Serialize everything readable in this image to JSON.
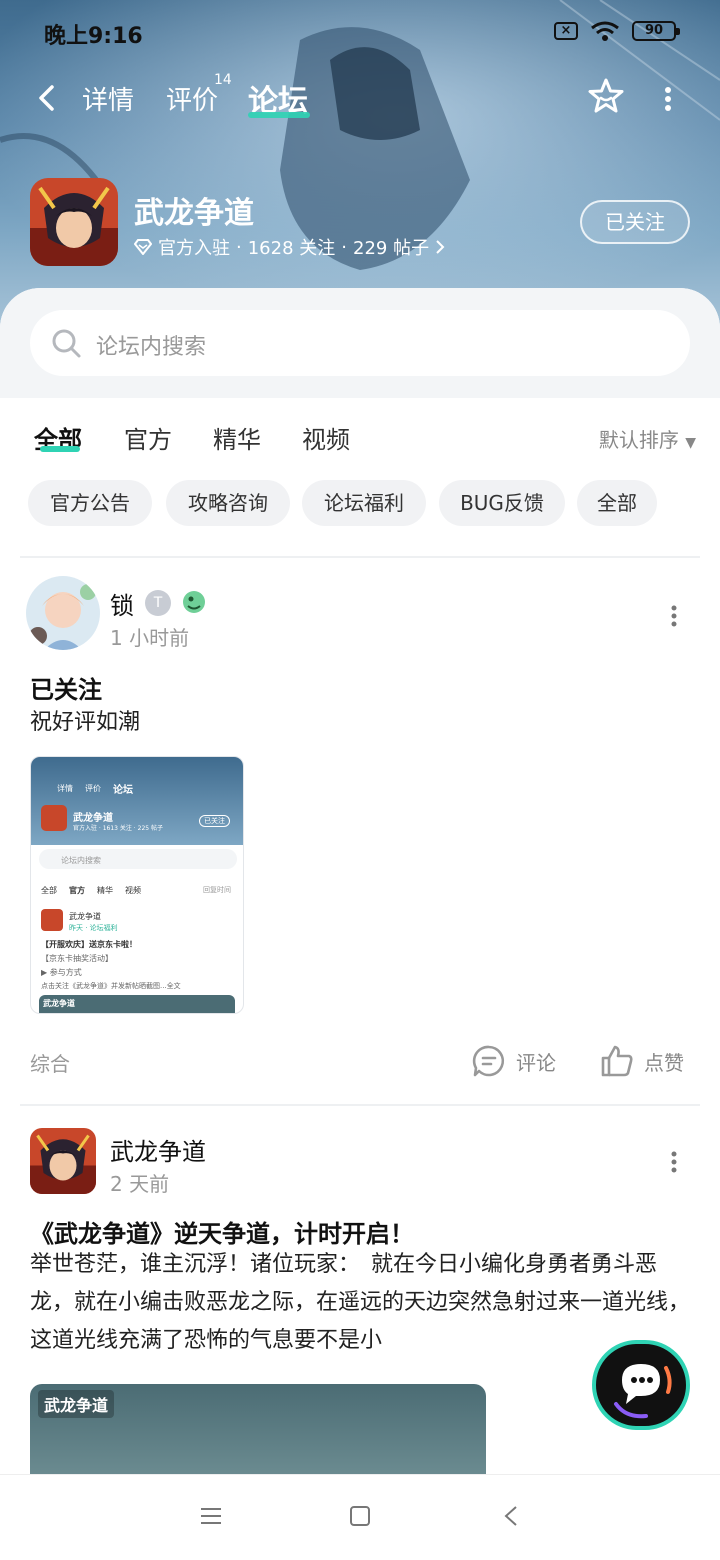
{
  "status_bar": {
    "time": "晚上9:16",
    "battery": "90"
  },
  "nav": {
    "tabs": [
      {
        "label": "详情"
      },
      {
        "label": "评价",
        "badge": "14"
      },
      {
        "label": "论坛"
      }
    ]
  },
  "game": {
    "title": "武龙争道",
    "official": "官方入驻",
    "followers": "1628 关注",
    "posts": "229 帖子",
    "follow_label": "已关注"
  },
  "search": {
    "placeholder": "论坛内搜索"
  },
  "categories": [
    "全部",
    "官方",
    "精华",
    "视频"
  ],
  "sort_label": "默认排序",
  "chips": [
    "官方公告",
    "攻略咨询",
    "论坛福利",
    "BUG反馈",
    "全部"
  ],
  "posts": [
    {
      "author": "锁",
      "level": "T",
      "time": "1 小时前",
      "title": "已关注",
      "body": "祝好评如潮",
      "tag": "综合",
      "comment_label": "评论",
      "like_label": "点赞",
      "thumb": {
        "tabs": [
          "详情",
          "评价",
          "论坛"
        ],
        "title": "武龙争道",
        "meta": "官方入驻 · 1613 关注 · 225 帖子",
        "follow": "已关注",
        "search": "论坛内搜索",
        "cats": [
          "全部",
          "官方",
          "精华",
          "视频"
        ],
        "sort": "回复时间",
        "author": "武龙争道",
        "when": "昨天 · 论坛福利",
        "line1": "【开服欢庆】送京东卡啦！",
        "line2": "【京东卡抽奖活动】",
        "line3": "▶ 参与方式",
        "line4": "点击关注《武龙争道》并发新帖晒截图...全文",
        "logo": "武龙争道"
      }
    },
    {
      "author": "武龙争道",
      "time": "2 天前",
      "title": "《武龙争道》逆天争道，计时开启！",
      "body": "举世苍茫，谁主沉浮！诸位玩家：　就在今日小编化身勇者勇斗恶龙，就在小编击败恶龙之际，在遥远的天边突然急射过来一道光线，这道光线充满了恐怖的气息要不是小",
      "image_logo": "武龙争道"
    }
  ],
  "colors": {
    "accent": "#2fd3b4",
    "banner": "#5a86a9"
  }
}
